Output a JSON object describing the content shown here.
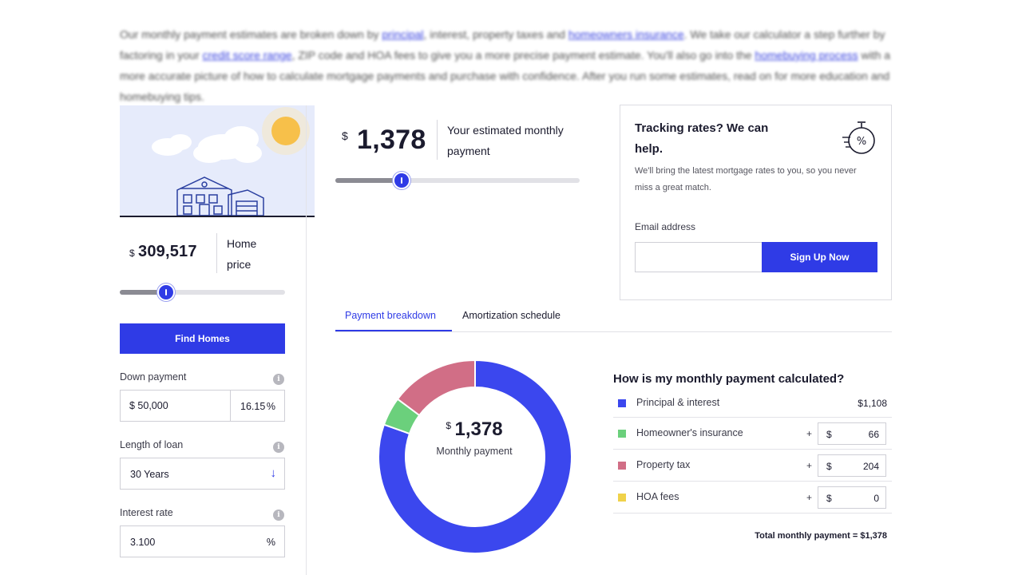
{
  "intro": {
    "p1": "Our monthly payment estimates are broken down by ",
    "link_principal": "principal",
    "p2": ", interest, property taxes and ",
    "link_insurance": "homeowners insurance",
    "p3": ". We take our calculator a step further by factoring in your ",
    "link_credit": "credit score range",
    "p4": ", ZIP code and HOA fees to give you a more precise payment estimate. You'll also go into the ",
    "link_process": "homebuying process",
    "p5": " with a more accurate picture of how to calculate mortgage payments and purchase with confidence. After you run some estimates, read on for more education and homebuying tips."
  },
  "home_price": {
    "currency": "$",
    "value": "309,517",
    "label": "Home price",
    "slider_fraction": 0.28
  },
  "find_homes_label": "Find Homes",
  "down_payment": {
    "label": "Down payment",
    "info": "i",
    "amount": "$ 50,000",
    "percent": "16.15",
    "percent_unit": "%"
  },
  "loan_length": {
    "label": "Length of loan",
    "info": "i",
    "value": "30 Years",
    "arrow": "↓"
  },
  "interest_rate": {
    "label": "Interest rate",
    "info": "i",
    "value": "3.100",
    "unit": "%"
  },
  "estimate": {
    "currency": "$",
    "value": "1,378",
    "label": "Your estimated monthly payment",
    "slider_fraction": 0.27
  },
  "tracking": {
    "title": "Tracking rates? We can help.",
    "description": "We'll bring the latest mortgage rates to you, so you never miss a great match.",
    "email_label": "Email address",
    "email_value": "",
    "signup_label": "Sign Up Now",
    "icon": "stopwatch-percent-icon"
  },
  "tabs": [
    {
      "label": "Payment breakdown",
      "active": true
    },
    {
      "label": "Amortization schedule",
      "active": false
    }
  ],
  "donut": {
    "currency": "$",
    "value": "1,378",
    "label": "Monthly payment"
  },
  "chart_data": {
    "type": "pie",
    "variant": "donut",
    "labels": [
      "Principal & interest",
      "Homeowner's insurance",
      "Property tax",
      "HOA fees"
    ],
    "values": [
      1108,
      66,
      204,
      0
    ],
    "colors": [
      "#3b47ee",
      "#6bd07c",
      "#d16e86",
      "#f0d24a"
    ]
  },
  "breakdown": {
    "title": "How is my monthly payment calculated?",
    "rows": [
      {
        "label": "Principal & interest",
        "color": "#3b47ee",
        "static_value": "$1,108"
      },
      {
        "label": "Homeowner's insurance",
        "color": "#6bd07c",
        "plus": "+",
        "currency": "$",
        "value": "66"
      },
      {
        "label": "Property tax",
        "color": "#d16e86",
        "plus": "+",
        "currency": "$",
        "value": "204"
      },
      {
        "label": "HOA fees",
        "color": "#f0d24a",
        "plus": "+",
        "currency": "$",
        "value": "0"
      }
    ],
    "total": "Total monthly payment = $1,378"
  }
}
